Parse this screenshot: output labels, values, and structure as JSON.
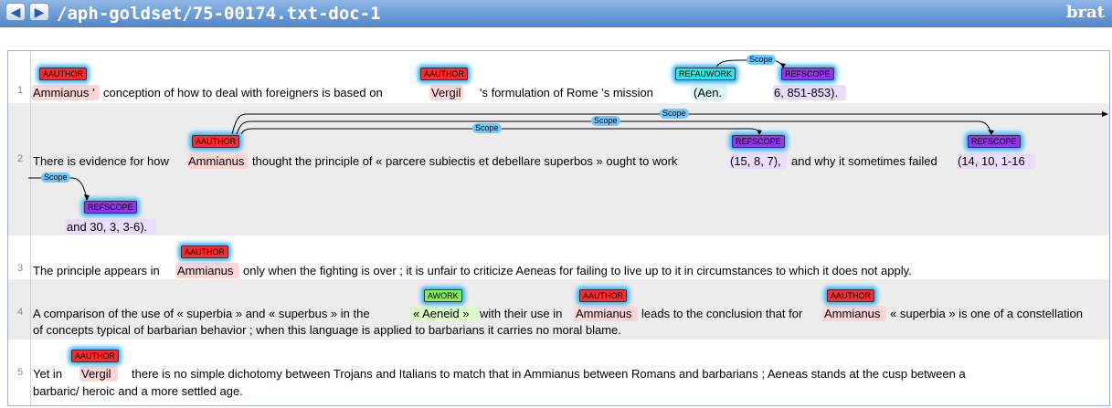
{
  "header": {
    "back_icon": "left-arrow-icon",
    "forward_icon": "right-arrow-icon",
    "doc_path": "/aph-goldset/75-00174.txt-doc-1",
    "brand": "brat"
  },
  "colors": {
    "aauthor": "#ff2b2b",
    "refscope": "#9535e8",
    "refauwork": "#29e5e5",
    "awork": "#7ef04d",
    "scope_arc": "#6fc7ff"
  },
  "sentences": [
    {
      "num": "1",
      "parts": [
        "Ammianus '",
        "conception of how to deal with foreigners is based on",
        "Vergil",
        "'s formulation of Rome 's mission",
        "(Aen.",
        "6, 851-853)."
      ],
      "labels": [
        "AAUTHOR",
        "AAUTHOR",
        "REFAUWORK",
        "REFSCOPE"
      ],
      "arcs": [
        "Scope"
      ]
    },
    {
      "num": "2",
      "line1": [
        "There is evidence for how",
        "Ammianus",
        "thought the principle of « parcere subiectis et debellare superbos » ought to work",
        "(15, 8, 7),",
        "and why it sometimes failed",
        "(14, 10, 1-16"
      ],
      "line2": [
        "and 30, 3, 3-6)."
      ],
      "labels": [
        "AAUTHOR",
        "REFSCOPE",
        "REFSCOPE",
        "REFSCOPE"
      ],
      "arcs": [
        "Scope",
        "Scope",
        "Scope",
        "Scope"
      ]
    },
    {
      "num": "3",
      "parts": [
        "The principle appears in",
        "Ammianus",
        "only when the fighting is over ; it is unfair to criticize Aeneas for failing to live up to it in circumstances to which it does not apply."
      ],
      "labels": [
        "AAUTHOR"
      ]
    },
    {
      "num": "4",
      "line1": [
        "A comparison of the use of « superbia » and « superbus » in the",
        "« Aeneid »",
        "with their use in",
        "Ammianus",
        "leads to the conclusion that for",
        "Ammianus",
        "« superbia » is one of a constellation"
      ],
      "line2": [
        "of concepts typical of barbarian behavior ; when this language is applied to barbarians it carries no moral blame."
      ],
      "labels": [
        "AWORK",
        "AAUTHOR",
        "AAUTHOR"
      ]
    },
    {
      "num": "5",
      "line1": [
        "Yet in",
        "Vergil",
        "there is no simple dichotomy between Trojans and Italians to match that in Ammianus between Romans and barbarians ; Aeneas stands at the cusp between a"
      ],
      "line2": [
        "barbaric/ heroic and a more settled age."
      ],
      "labels": [
        "AAUTHOR"
      ]
    }
  ]
}
